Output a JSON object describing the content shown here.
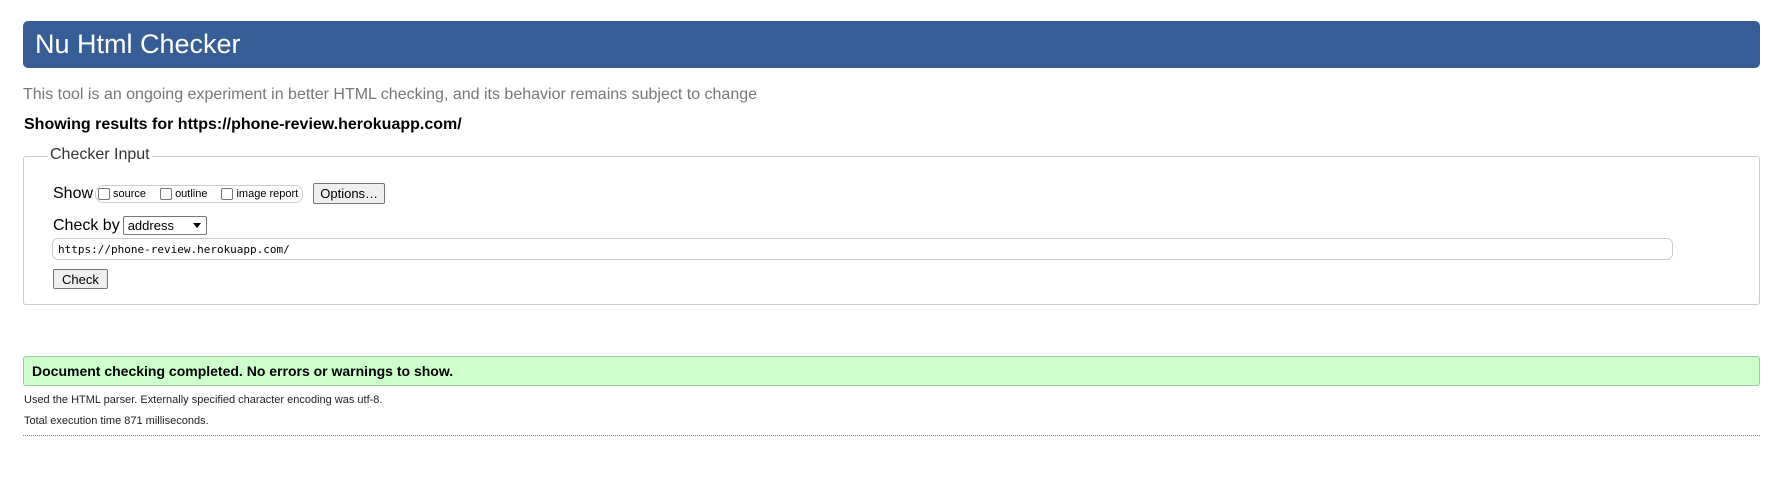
{
  "header": {
    "title": "Nu Html Checker"
  },
  "tagline": "This tool is an ongoing experiment in better HTML checking, and its behavior remains subject to change",
  "results_heading": "Showing results for https://phone-review.herokuapp.com/",
  "checker_input": {
    "legend": "Checker Input",
    "show_label": "Show",
    "show_options": [
      {
        "label": "source",
        "checked": false
      },
      {
        "label": "outline",
        "checked": false
      },
      {
        "label": "image report",
        "checked": false
      }
    ],
    "options_button": "Options…",
    "check_by_label": "Check by",
    "check_by_selected": "address",
    "url_value": "https://phone-review.herokuapp.com/",
    "check_button": "Check"
  },
  "result": {
    "message": "Document checking completed. No errors or warnings to show.",
    "status_color": "#ccffcc"
  },
  "details": {
    "parser_info": "Used the HTML parser. Externally specified character encoding was utf-8.",
    "execution_time": "Total execution time 871 milliseconds."
  },
  "colors": {
    "header_bg": "#365d95",
    "tagline": "#777777"
  }
}
